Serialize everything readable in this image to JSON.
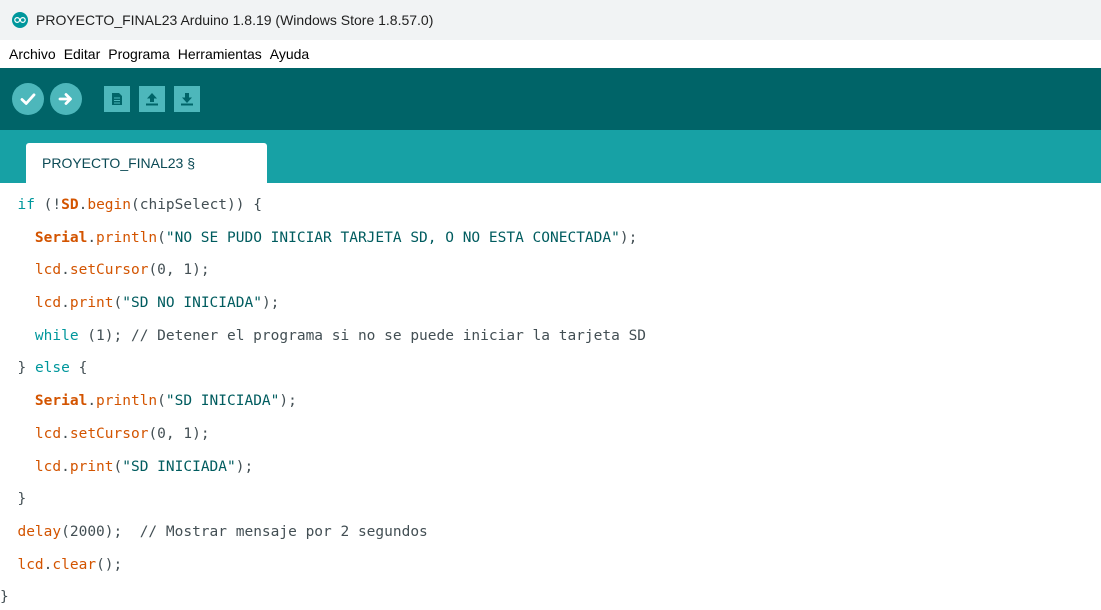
{
  "window": {
    "title": "PROYECTO_FINAL23 Arduino 1.8.19 (Windows Store 1.8.57.0)"
  },
  "menu": {
    "items": [
      "Archivo",
      "Editar",
      "Programa",
      "Herramientas",
      "Ayuda"
    ]
  },
  "toolbar": {
    "buttons": [
      "verify-icon",
      "upload-icon",
      "new-icon",
      "open-icon",
      "save-icon"
    ]
  },
  "tabs": [
    {
      "label": "PROYECTO_FINAL23 §"
    }
  ],
  "colors": {
    "toolbar_bg": "#006468",
    "tabstrip_bg": "#17a1a5",
    "button_bg": "#4db7bb",
    "keyword": "#00979c",
    "function": "#d35400",
    "string": "#005c5f",
    "default_text": "#434f54"
  },
  "code": {
    "indent": [
      "  ",
      "    ",
      "    ",
      "    ",
      "    ",
      "  ",
      "    ",
      "    ",
      "    ",
      "  ",
      "  ",
      "  ",
      ""
    ],
    "lines": [
      [
        {
          "t": "if",
          "c": "kw"
        },
        {
          "t": " (!"
        },
        {
          "t": "SD",
          "c": "cls"
        },
        {
          "t": "."
        },
        {
          "t": "begin",
          "c": "fn"
        },
        {
          "t": "(chipSelect)) {"
        }
      ],
      [
        {
          "t": "Serial",
          "c": "cls"
        },
        {
          "t": "."
        },
        {
          "t": "println",
          "c": "fn"
        },
        {
          "t": "("
        },
        {
          "t": "\"NO SE PUDO INICIAR TARJETA SD, O NO ESTA CONECTADA\"",
          "c": "str"
        },
        {
          "t": ");"
        }
      ],
      [
        {
          "t": "lcd",
          "c": "fn"
        },
        {
          "t": "."
        },
        {
          "t": "setCursor",
          "c": "fn"
        },
        {
          "t": "(0, 1);"
        }
      ],
      [
        {
          "t": "lcd",
          "c": "fn"
        },
        {
          "t": "."
        },
        {
          "t": "print",
          "c": "fn"
        },
        {
          "t": "("
        },
        {
          "t": "\"SD NO INICIADA\"",
          "c": "str"
        },
        {
          "t": ");"
        }
      ],
      [
        {
          "t": "while",
          "c": "kw"
        },
        {
          "t": " (1); "
        },
        {
          "t": "// Detener el programa si no se puede iniciar la tarjeta SD",
          "c": "cm"
        }
      ],
      [
        {
          "t": "} "
        },
        {
          "t": "else",
          "c": "kw"
        },
        {
          "t": " {"
        }
      ],
      [
        {
          "t": "Serial",
          "c": "cls"
        },
        {
          "t": "."
        },
        {
          "t": "println",
          "c": "fn"
        },
        {
          "t": "("
        },
        {
          "t": "\"SD INICIADA\"",
          "c": "str"
        },
        {
          "t": ");"
        }
      ],
      [
        {
          "t": "lcd",
          "c": "fn"
        },
        {
          "t": "."
        },
        {
          "t": "setCursor",
          "c": "fn"
        },
        {
          "t": "(0, 1);"
        }
      ],
      [
        {
          "t": "lcd",
          "c": "fn"
        },
        {
          "t": "."
        },
        {
          "t": "print",
          "c": "fn"
        },
        {
          "t": "("
        },
        {
          "t": "\"SD INICIADA\"",
          "c": "str"
        },
        {
          "t": ");"
        }
      ],
      [
        {
          "t": "}"
        }
      ],
      [
        {
          "t": "delay",
          "c": "fn"
        },
        {
          "t": "(2000);  "
        },
        {
          "t": "// Mostrar mensaje por 2 segundos",
          "c": "cm"
        }
      ],
      [
        {
          "t": "lcd",
          "c": "fn"
        },
        {
          "t": "."
        },
        {
          "t": "clear",
          "c": "fn"
        },
        {
          "t": "();"
        }
      ],
      [
        {
          "t": "}"
        }
      ]
    ]
  }
}
